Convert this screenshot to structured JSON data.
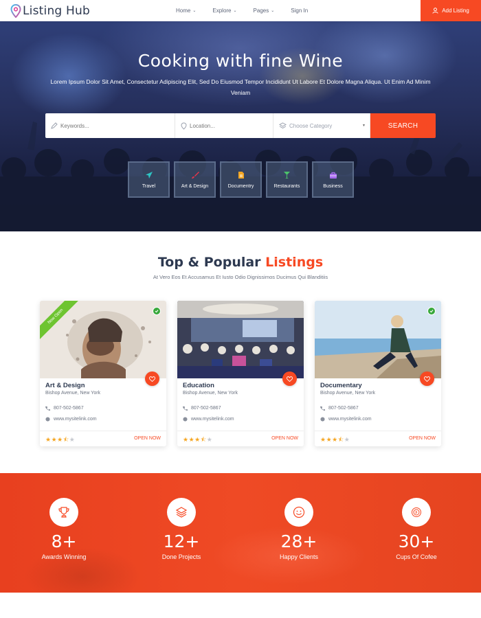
{
  "header": {
    "logo_text": "Listing Hub",
    "nav": [
      {
        "label": "Home"
      },
      {
        "label": "Explore"
      },
      {
        "label": "Pages"
      },
      {
        "label": "Sign In"
      }
    ],
    "add_listing": "Add Listing"
  },
  "hero": {
    "title": "Cooking with fine Wine",
    "subtitle": "Lorem Ipsum Dolor Sit Amet, Consectetur Adipiscing Elit, Sed Do Eiusmod Tempor Incididunt Ut Labore Et Dolore Magna Aliqua. Ut Enim Ad Minim Veniam",
    "search": {
      "keywords_placeholder": "Keywords...",
      "location_placeholder": "Location...",
      "category_placeholder": "Choose Category",
      "button": "SEARCH"
    },
    "categories": [
      {
        "label": "Travel",
        "icon": "airplane-icon",
        "color": "#2ec4c4"
      },
      {
        "label": "Art & Design",
        "icon": "brush-icon",
        "color": "#e8344a"
      },
      {
        "label": "Documentry",
        "icon": "document-icon",
        "color": "#f5a623"
      },
      {
        "label": "Restaurants",
        "icon": "glass-icon",
        "color": "#4cc26a"
      },
      {
        "label": "Business",
        "icon": "briefcase-icon",
        "color": "#a86bf0"
      }
    ]
  },
  "listings": {
    "title_main": "Top & Popular",
    "title_accent": "Listings",
    "subtitle": "At Vero Eos Et Accusamus Et Iusto Odio Dignissimos Ducimus Qui Blanditiis",
    "cards": [
      {
        "title": "Art & Design",
        "address": "Bishop Avenue, New York",
        "phone": "807-502-5867",
        "website": "www.mysitelink.com",
        "rating": 3.5,
        "status": "OPEN NOW",
        "ribbon": "Now Open",
        "verified": true
      },
      {
        "title": "Education",
        "address": "Bishop Avenue, New York",
        "phone": "807-502-5867",
        "website": "www.mysitelink.com",
        "rating": 3.5,
        "status": "OPEN NOW",
        "verified": false
      },
      {
        "title": "Documentary",
        "address": "Bishop Avenue, New York",
        "phone": "807-502-5867",
        "website": "www.mysitelink.com",
        "rating": 3.5,
        "status": "OPEN NOW",
        "verified": true
      }
    ]
  },
  "counters": [
    {
      "value": "8+",
      "label": "Awards Winning",
      "icon": "trophy-icon"
    },
    {
      "value": "12+",
      "label": "Done Projects",
      "icon": "layers-icon"
    },
    {
      "value": "28+",
      "label": "Happy Clients",
      "icon": "smile-icon"
    },
    {
      "value": "30+",
      "label": "Cups Of Cofee",
      "icon": "coffee-icon"
    }
  ],
  "colors": {
    "accent": "#f74923",
    "navy": "#2d3950",
    "ribbon": "#6ec431",
    "verified": "#38a83b",
    "star": "#f5a623"
  }
}
